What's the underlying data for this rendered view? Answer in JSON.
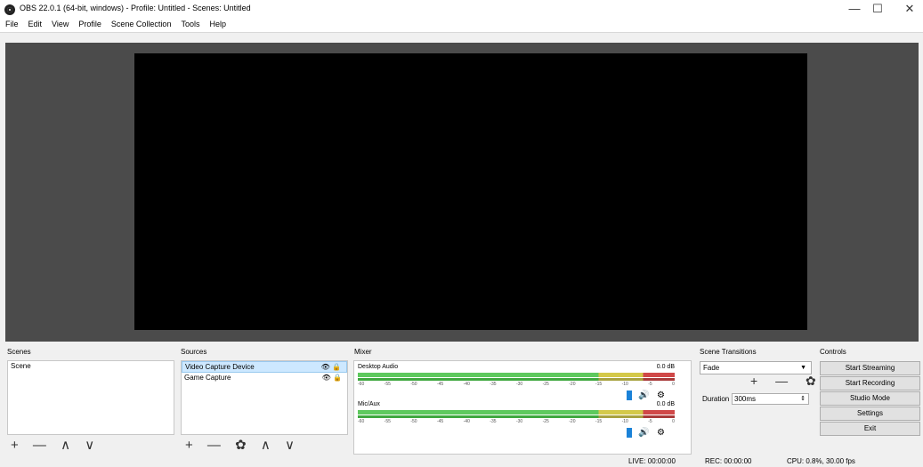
{
  "window": {
    "title": "OBS 22.0.1 (64-bit, windows) - Profile: Untitled - Scenes: Untitled",
    "minimize_glyph": "—",
    "maximize_glyph": "☐",
    "close_glyph": "✕"
  },
  "menu": [
    "File",
    "Edit",
    "View",
    "Profile",
    "Scene Collection",
    "Tools",
    "Help"
  ],
  "docks": {
    "scenes": {
      "title": "Scenes",
      "items": [
        "Scene"
      ],
      "toolbar": "+ — ∧ ∨"
    },
    "sources": {
      "title": "Sources",
      "items": [
        {
          "label": "Video Capture Device",
          "selected": true
        },
        {
          "label": "Game Capture",
          "selected": false
        }
      ],
      "toolbar": "+ — ✿ ∧ ∨"
    },
    "mixer": {
      "title": "Mixer",
      "channels": [
        {
          "name": "Desktop Audio",
          "db": "0.0 dB"
        },
        {
          "name": "Mic/Aux",
          "db": "0.0 dB"
        }
      ],
      "ticks": [
        "-60",
        "-55",
        "-50",
        "-45",
        "-40",
        "-35",
        "-30",
        "-25",
        "-20",
        "-15",
        "-10",
        "-5",
        "0"
      ]
    },
    "transitions": {
      "title": "Scene Transitions",
      "selected": "Fade",
      "toolbar": "+ — ✿",
      "duration_label": "Duration",
      "duration_value": "300ms"
    },
    "controls": {
      "title": "Controls",
      "buttons": [
        "Start Streaming",
        "Start Recording",
        "Studio Mode",
        "Settings",
        "Exit"
      ]
    }
  },
  "status": {
    "live": "LIVE: 00:00:00",
    "rec": "REC: 00:00:00",
    "cpu": "CPU: 0.8%, 30.00 fps"
  }
}
